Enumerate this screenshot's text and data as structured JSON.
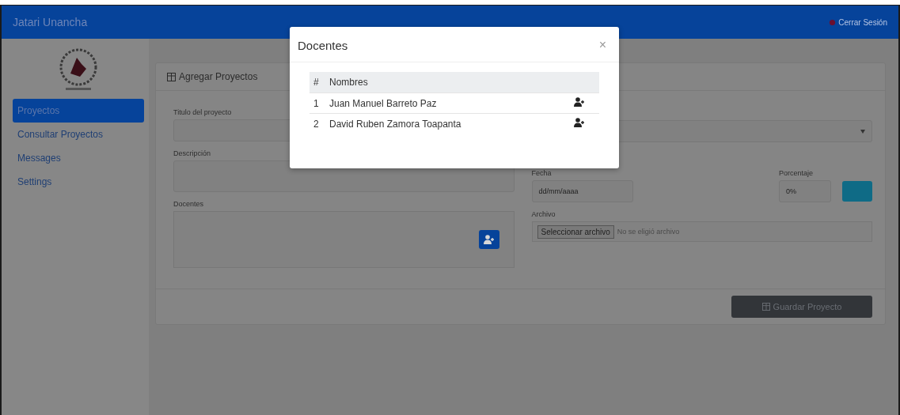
{
  "navbar": {
    "brand": "Jatari Unancha",
    "logout": "Cerrar Sesión"
  },
  "sidebar": {
    "items": [
      {
        "label": "Proyectos",
        "selected": true
      },
      {
        "label": "Consultar Proyectos",
        "selected": false
      },
      {
        "label": "Messages",
        "selected": false
      },
      {
        "label": "Settings",
        "selected": false
      }
    ]
  },
  "card": {
    "title": "Agregar Proyectos",
    "form": {
      "title_label": "Titulo del proyecto",
      "description_label": "Descripción",
      "teachers_label": "Docentes",
      "date_label": "Fecha",
      "date_placeholder": "dd/mm/aaaa",
      "percent_label": "Porcentaje",
      "percent_value": "0%",
      "file_label": "Archivo",
      "file_button": "Seleccionar archivo",
      "file_status": "No se eligió archivo"
    },
    "save_button": "Guardar Proyecto"
  },
  "modal": {
    "title": "Docentes",
    "close": "×",
    "columns": [
      "#",
      "Nombres"
    ],
    "rows": [
      {
        "number": "1",
        "name": "Juan Manuel Barreto Paz"
      },
      {
        "number": "2",
        "name": "David Ruben Zamora Toapanta"
      }
    ]
  }
}
